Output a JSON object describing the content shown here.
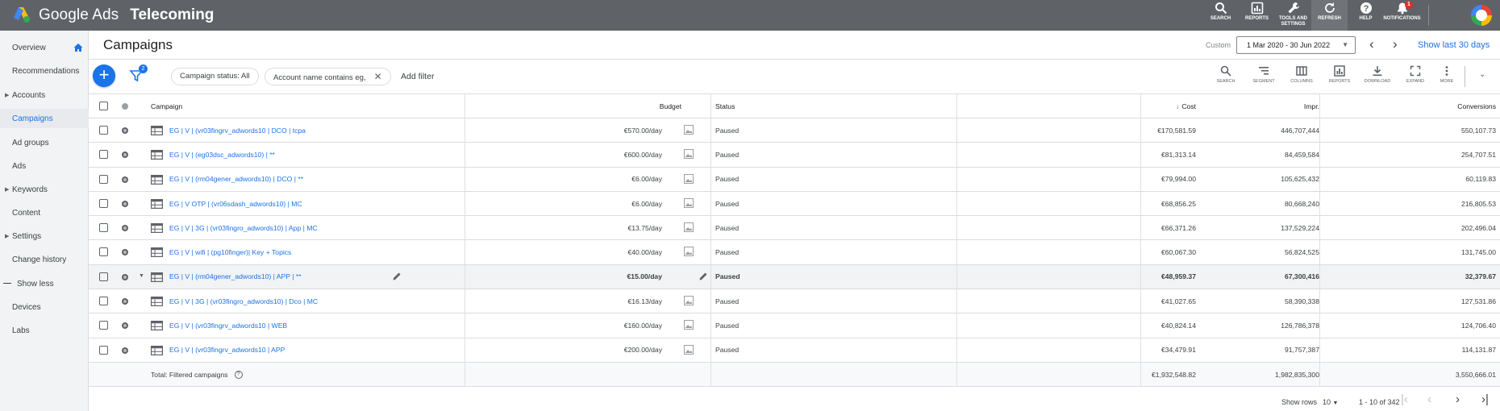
{
  "app": {
    "brand": "Google Ads",
    "account": "Telecoming"
  },
  "topnav": [
    {
      "label": "SEARCH",
      "icon": "search-icon"
    },
    {
      "label": "REPORTS",
      "icon": "reports-icon"
    },
    {
      "label": "TOOLS AND SETTINGS",
      "icon": "wrench-icon"
    },
    {
      "label": "REFRESH",
      "icon": "refresh-icon"
    },
    {
      "label": "HELP",
      "icon": "help-icon"
    },
    {
      "label": "NOTIFICATIONS",
      "icon": "bell-icon",
      "badge": "1"
    }
  ],
  "sidebar": {
    "items": [
      {
        "label": "Overview"
      },
      {
        "label": "Recommendations"
      },
      {
        "label": "Accounts"
      },
      {
        "label": "Campaigns"
      },
      {
        "label": "Ad groups"
      },
      {
        "label": "Ads"
      },
      {
        "label": "Keywords"
      },
      {
        "label": "Content"
      },
      {
        "label": "Settings"
      },
      {
        "label": "Change history"
      },
      {
        "label": "Show less"
      },
      {
        "label": "Devices"
      },
      {
        "label": "Labs"
      }
    ]
  },
  "header": {
    "title": "Campaigns",
    "custom_label": "Custom",
    "date_range": "1 Mar 2020 - 30 Jun 2022",
    "show_last": "Show last 30 days"
  },
  "toolbar": {
    "filter_count": "2",
    "chip1": "Campaign status: All",
    "chip2": "Account name contains eg,",
    "add_filter": "Add filter",
    "tools": [
      "SEARCH",
      "SEGMENT",
      "COLUMNS",
      "REPORTS",
      "DOWNLOAD",
      "EXPAND",
      "MORE"
    ]
  },
  "table": {
    "headers": {
      "campaign": "Campaign",
      "budget": "Budget",
      "status": "Status",
      "cost": "Cost",
      "impr": "Impr.",
      "conversions": "Conversions"
    },
    "rows": [
      {
        "campaign": "EG | V | (vr03fingrv_adwords10 | DCO | tcpa",
        "budget": "€570.00/day",
        "status": "Paused",
        "cost": "€170,581.59",
        "impr": "446,707,444",
        "conversions": "550,107.73"
      },
      {
        "campaign": "EG | V | (eg03dsc_adwords10) | **",
        "budget": "€600.00/day",
        "status": "Paused",
        "cost": "€81,313.14",
        "impr": "84,459,584",
        "conversions": "254,707.51"
      },
      {
        "campaign": "EG | V | (rm04gener_adwords10) | DCO | **",
        "budget": "€6.00/day",
        "status": "Paused",
        "cost": "€79,994.00",
        "impr": "105,625,432",
        "conversions": "60,119.83"
      },
      {
        "campaign": "EG | V OTP | (vr06sdash_adwords10) | MC",
        "budget": "€6.00/day",
        "status": "Paused",
        "cost": "€68,856.25",
        "impr": "80,668,240",
        "conversions": "216,805.53"
      },
      {
        "campaign": "EG | V | 3G | (vr03fingro_adwords10) | App | MC",
        "budget": "€13.75/day",
        "status": "Paused",
        "cost": "€66,371.26",
        "impr": "137,529,224",
        "conversions": "202,496.04"
      },
      {
        "campaign": "EG | V | wifi | (pg10finger)| Key + Topics",
        "budget": "€40.00/day",
        "status": "Paused",
        "cost": "€60,067.30",
        "impr": "56,824,525",
        "conversions": "131,745.00"
      },
      {
        "campaign": "EG | V | (rm04gener_adwords10) | APP | **",
        "budget": "€15.00/day",
        "status": "Paused",
        "cost": "€48,959.37",
        "impr": "67,300,416",
        "conversions": "32,379.67"
      },
      {
        "campaign": "EG | V | 3G | (vr03fingro_adwords10) | Dco | MC",
        "budget": "€16.13/day",
        "status": "Paused",
        "cost": "€41,027.65",
        "impr": "58,390,338",
        "conversions": "127,531.86"
      },
      {
        "campaign": "EG | V | (vr03fingrv_adwords10 | WEB",
        "budget": "€160.00/day",
        "status": "Paused",
        "cost": "€40,824.14",
        "impr": "126,786,378",
        "conversions": "124,706.40"
      },
      {
        "campaign": "EG | V | (vr03fingrv_adwords10 | APP",
        "budget": "€200.00/day",
        "status": "Paused",
        "cost": "€34,479.91",
        "impr": "91,757,387",
        "conversions": "114,131.87"
      }
    ],
    "total": {
      "label": "Total: Filtered campaigns",
      "cost": "€1,932,548.82",
      "impr": "1,982,835,300",
      "conversions": "3,550,666.01"
    }
  },
  "footer": {
    "show_rows_label": "Show rows",
    "show_rows_value": "10",
    "range": "1 - 10 of 342"
  }
}
